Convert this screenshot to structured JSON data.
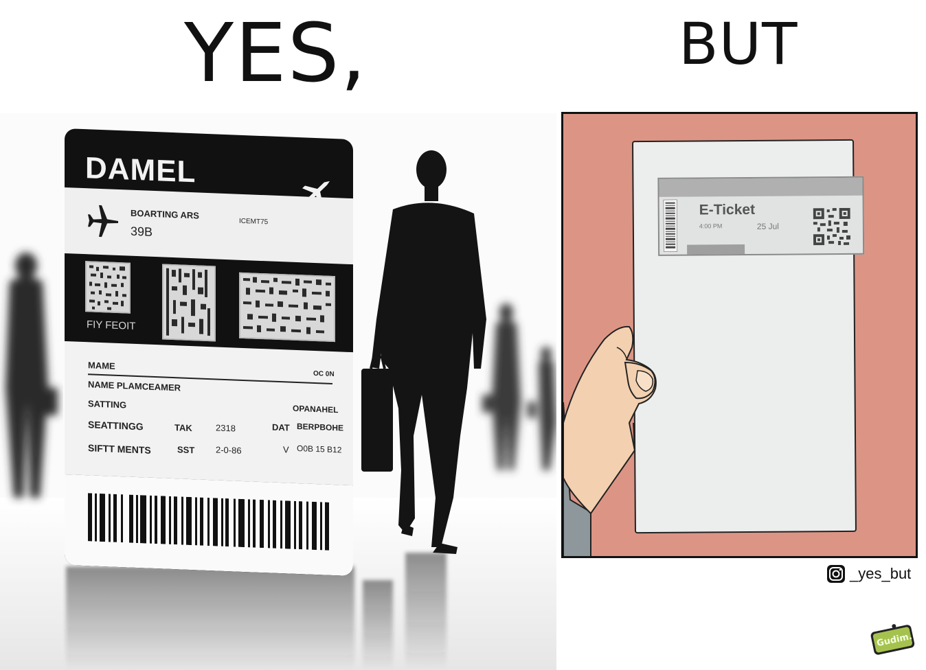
{
  "left": {
    "heading": "YES,",
    "boarding_pass": {
      "airline": "DAMEL",
      "boarding_label": "BOARTING ARS",
      "boarding_value": "39B",
      "code_label": "ICEMT75",
      "qr_caption": "FIY FEOIT",
      "rows": [
        {
          "c1": "MAME",
          "c2": "",
          "c3": "",
          "c4": "OC 0N"
        },
        {
          "c1": "NAME PLAMCEAMER",
          "c2": "",
          "c3": "",
          "c4": ""
        },
        {
          "c1": "SATTING",
          "c2": "",
          "c3": "",
          "c4": "OPANAHEL"
        },
        {
          "c1": "SEATTINGG",
          "c2": "TAK",
          "c3": "2318",
          "c4": "DAT",
          "c5": "BERPBOHE"
        },
        {
          "c1": "SIFTT MENTS",
          "c2": "SST",
          "c3": "2-0-86",
          "c4": "V",
          "c5": "O0B 15 B12"
        }
      ]
    }
  },
  "right": {
    "heading": "BUT",
    "eticket": {
      "title": "E-Ticket",
      "time": "4:00 PM",
      "date": "25 Jul"
    }
  },
  "credit": {
    "instagram_icon": "instagram-icon",
    "handle": "_yes_but",
    "badge": "Gudim."
  },
  "colors": {
    "right_panel_bg": "#dc9585",
    "paper": "#eceeee",
    "skin": "#f2d0b0"
  }
}
